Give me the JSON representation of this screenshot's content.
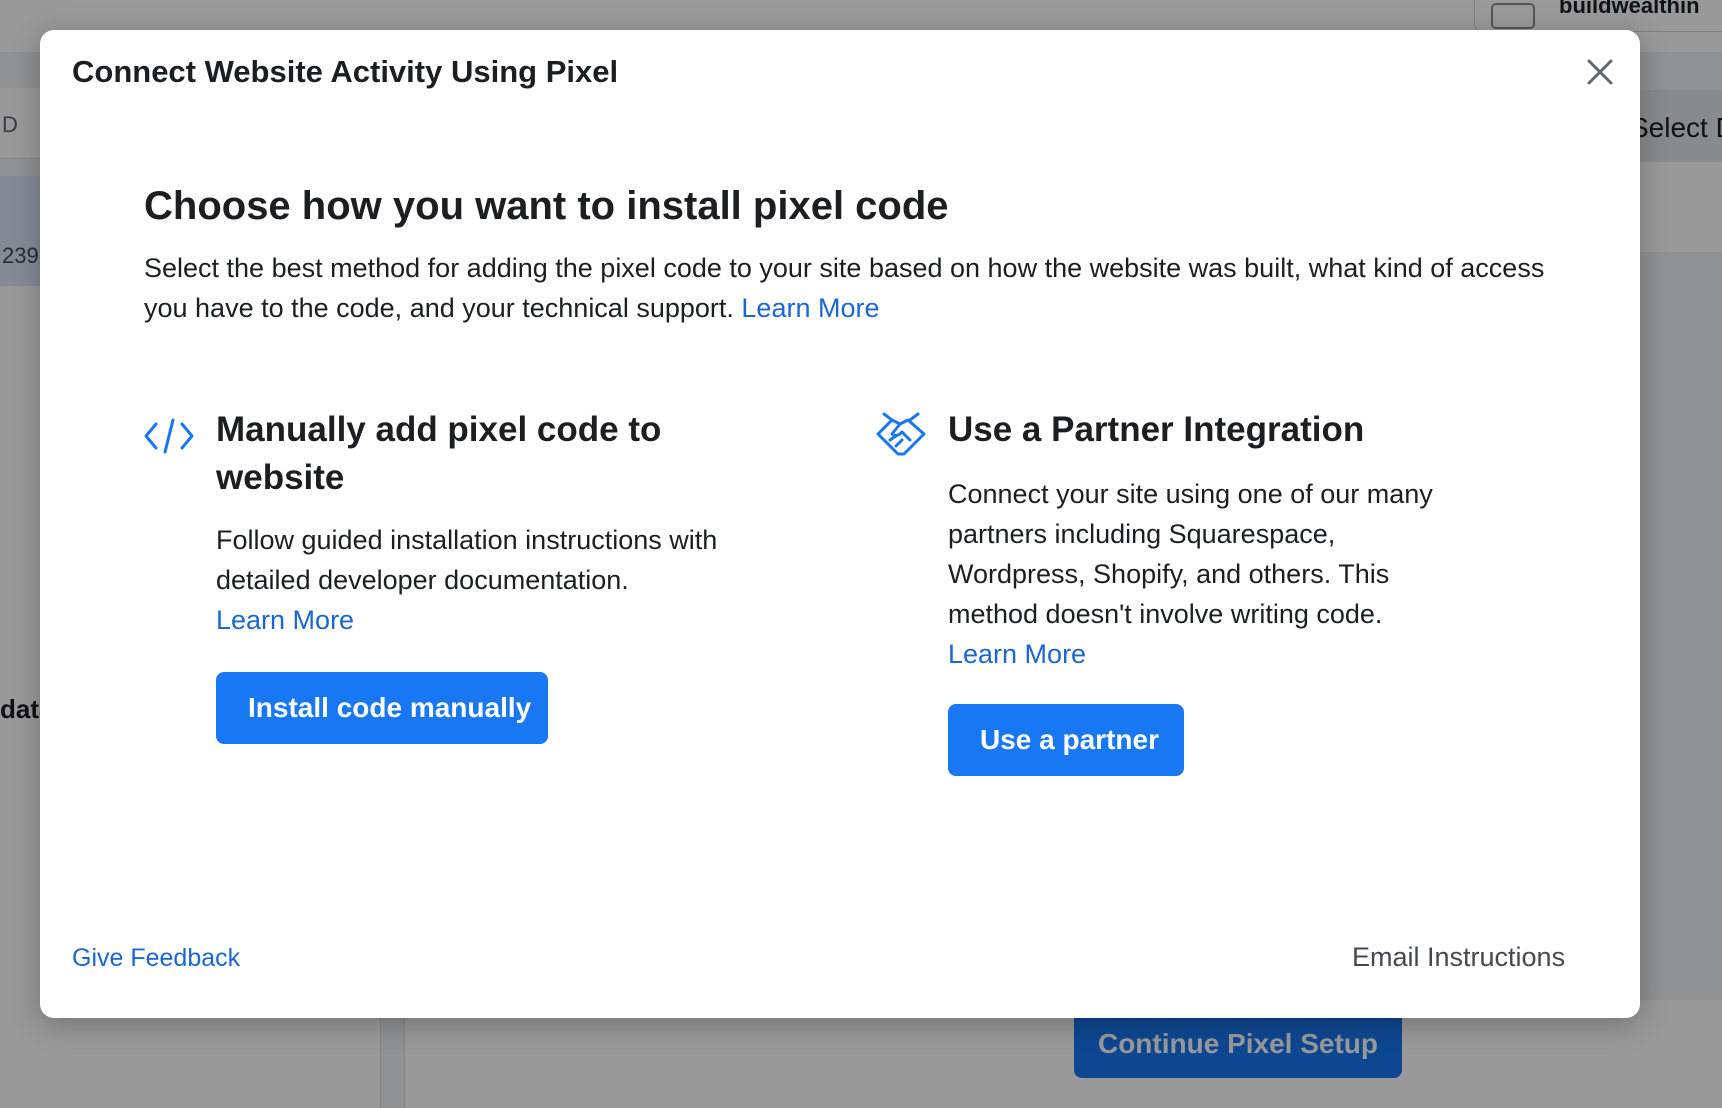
{
  "background": {
    "account_name": "buildwealthin",
    "column_label": "D",
    "row_id": "239",
    "data_label": "data",
    "select_label": "Select Da",
    "continue_label": "Continue Pixel Setup"
  },
  "modal": {
    "title": "Connect Website Activity Using Pixel",
    "close_icon": "close-icon",
    "heading": "Choose how you want to install pixel code",
    "description": "Select the best method for adding the pixel code to your site based on how the website was built, what kind of access you have to the code, and your technical support.",
    "description_link": "Learn More",
    "options": [
      {
        "icon": "code-icon",
        "title": "Manually add pixel code to website",
        "description": "Follow guided installation instructions with detailed developer documentation.",
        "link": "Learn More",
        "button": "Install code manually"
      },
      {
        "icon": "handshake-icon",
        "title": "Use a Partner Integration",
        "description": "Connect your site using one of our many partners including Squarespace, Wordpress, Shopify, and others. This method doesn't involve writing code.",
        "link": "Learn More",
        "button": "Use a partner"
      }
    ],
    "footer": {
      "feedback": "Give Feedback",
      "email": "Email Instructions"
    },
    "colors": {
      "primary": "#1877f2",
      "link": "#1a66d3",
      "text": "#1c1e21"
    }
  }
}
